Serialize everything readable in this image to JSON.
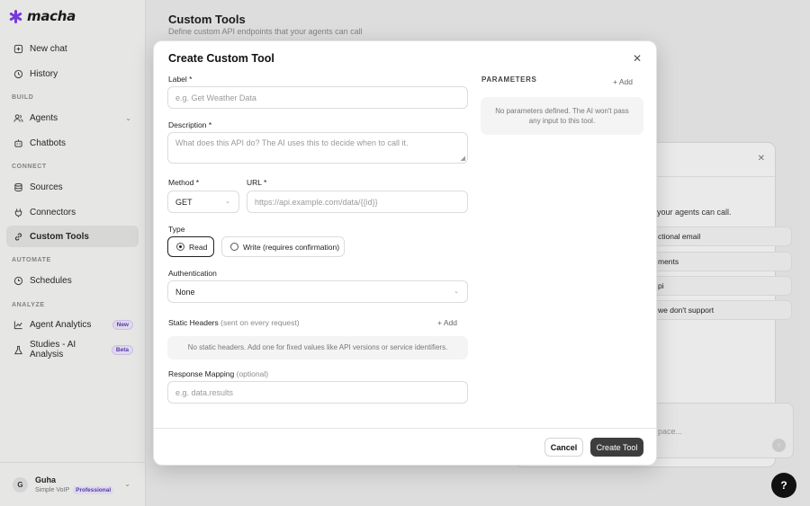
{
  "app": {
    "logo_text": "macha",
    "brand_color": "#7c3aed"
  },
  "sidebar": {
    "new_chat": "New chat",
    "history": "History",
    "build_label": "BUILD",
    "agents": "Agents",
    "chatbots": "Chatbots",
    "connect_label": "CONNECT",
    "sources": "Sources",
    "connectors": "Connectors",
    "custom_tools": "Custom Tools",
    "automate_label": "AUTOMATE",
    "schedules": "Schedules",
    "analyze_label": "ANALYZE",
    "agent_analytics": "Agent Analytics",
    "agent_analytics_badge": "New",
    "studies": "Studies - AI Analysis",
    "studies_badge": "Beta"
  },
  "user": {
    "initial": "G",
    "name": "Guha",
    "org": "Simple VoIP",
    "plan": "Professional"
  },
  "page": {
    "title": "Custom Tools",
    "subtitle": "Define custom API endpoints that your agents can call"
  },
  "background_panel": {
    "text": "your agents can call.",
    "rows": [
      "ctional email",
      "ments",
      "pi",
      "we don't support"
    ],
    "input_placeholder": "pace..."
  },
  "modal": {
    "title": "Create Custom Tool",
    "label_field": {
      "label": "Label *",
      "placeholder": "e.g. Get Weather Data"
    },
    "description_field": {
      "label": "Description *",
      "placeholder": "What does this API do? The AI uses this to decide when to call it."
    },
    "method_field": {
      "label": "Method *",
      "value": "GET"
    },
    "url_field": {
      "label": "URL *",
      "placeholder": "https://api.example.com/data/{{id}}"
    },
    "type_field": {
      "label": "Type",
      "options": [
        "Read",
        "Write (requires confirmation)"
      ],
      "selected": "Read"
    },
    "auth_field": {
      "label": "Authentication",
      "value": "None"
    },
    "static_headers": {
      "label": "Static Headers",
      "hint": "(sent on every request)",
      "add_label": "+ Add",
      "empty_text": "No static headers. Add one for fixed values like API versions or service identifiers."
    },
    "response_mapping": {
      "label": "Response Mapping",
      "hint": "(optional)",
      "placeholder": "e.g. data.results"
    },
    "parameters": {
      "title": "PARAMETERS",
      "add_label": "+ Add",
      "empty_text": "No parameters defined. The AI won't pass any input to this tool."
    },
    "cancel_label": "Cancel",
    "create_label": "Create Tool"
  },
  "help_label": "?"
}
